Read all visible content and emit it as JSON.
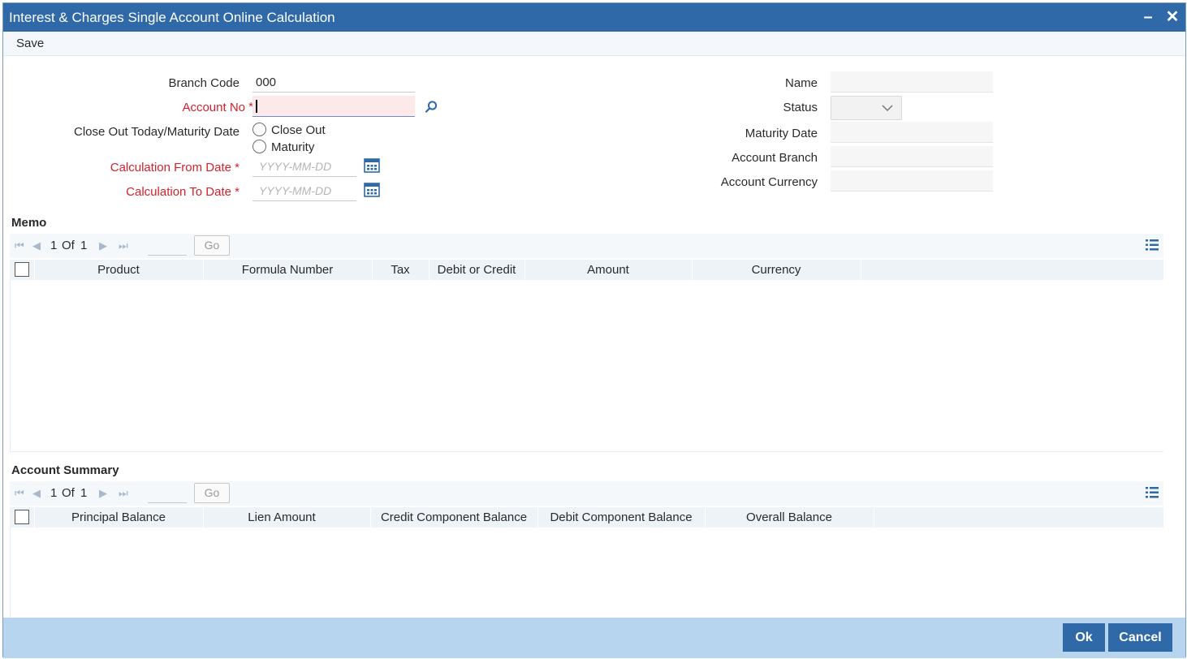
{
  "window": {
    "title": "Interest & Charges Single Account Online Calculation",
    "minimize_label": "–",
    "close_label": "✕"
  },
  "menu": {
    "save_label": "Save"
  },
  "form": {
    "branch_code_label": "Branch Code",
    "branch_code_value": "000",
    "account_no_label": "Account No",
    "required_mark": "*",
    "close_out_label": "Close Out Today/Maturity Date",
    "radio_close_out": "Close Out",
    "radio_maturity": "Maturity",
    "calc_from_label": "Calculation From Date",
    "calc_to_label": "Calculation To Date",
    "date_placeholder": "YYYY-MM-DD",
    "name_label": "Name",
    "status_label": "Status",
    "maturity_date_label": "Maturity Date",
    "account_branch_label": "Account Branch",
    "account_currency_label": "Account Currency"
  },
  "memo": {
    "title": "Memo",
    "pager": {
      "current": "1",
      "of_label": "Of",
      "total": "1",
      "go_label": "Go"
    },
    "columns": [
      "Product",
      "Formula Number",
      "Tax",
      "Debit or Credit",
      "Amount",
      "Currency"
    ]
  },
  "summary": {
    "title": "Account Summary",
    "pager": {
      "current": "1",
      "of_label": "Of",
      "total": "1",
      "go_label": "Go"
    },
    "columns": [
      "Principal Balance",
      "Lien Amount",
      "Credit Component Balance",
      "Debit Component Balance",
      "Overall Balance"
    ]
  },
  "footer": {
    "ok_label": "Ok",
    "cancel_label": "Cancel"
  },
  "colors": {
    "title_bar": "#2f69a8",
    "required": "#d6202b",
    "footer": "#b7d5ee"
  },
  "icons": [
    "search-icon",
    "calendar-icon",
    "chevron-down-icon",
    "first-page-icon",
    "prev-page-icon",
    "next-page-icon",
    "last-page-icon",
    "list-view-icon"
  ]
}
